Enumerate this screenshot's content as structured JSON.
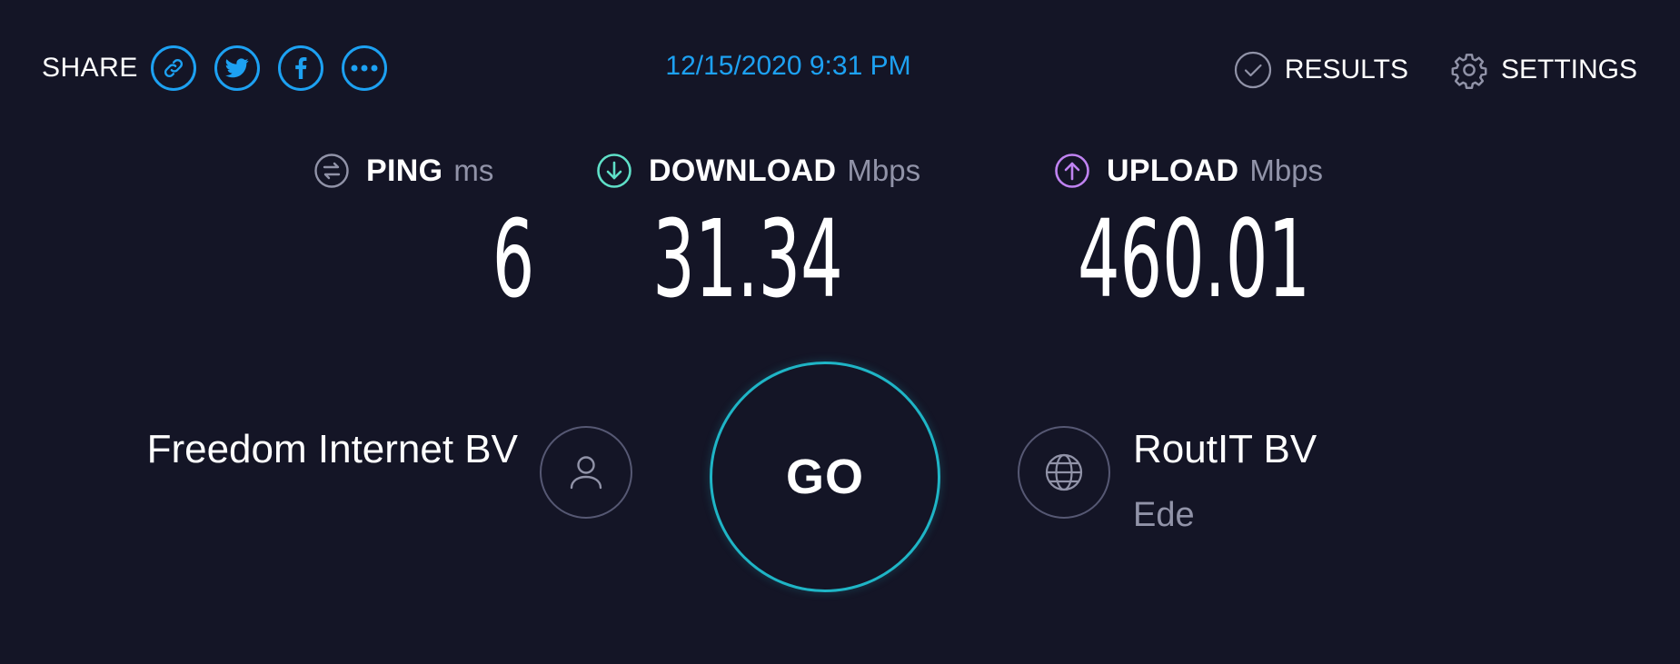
{
  "share": {
    "label": "SHARE",
    "buttons": [
      {
        "icon": "link-icon"
      },
      {
        "icon": "twitter-icon"
      },
      {
        "icon": "facebook-icon"
      },
      {
        "icon": "more-icon"
      }
    ]
  },
  "timestamp": "12/15/2020 9:31 PM",
  "nav": {
    "results_label": "RESULTS",
    "settings_label": "SETTINGS"
  },
  "metrics": {
    "ping": {
      "label": "PING",
      "unit": "ms",
      "value": "6"
    },
    "download": {
      "label": "DOWNLOAD",
      "unit": "Mbps",
      "value": "31.34"
    },
    "upload": {
      "label": "UPLOAD",
      "unit": "Mbps",
      "value": "460.01"
    }
  },
  "provider": {
    "name": "Freedom Internet BV"
  },
  "go_label": "GO",
  "server": {
    "name": "RoutIT BV",
    "location": "Ede"
  },
  "colors": {
    "background": "#141526",
    "accent_blue": "#1da1f2",
    "go_ring": "#1fb5c6",
    "download_accent": "#5fe0c8",
    "upload_accent": "#c083f2",
    "muted_text": "#9193a8"
  }
}
